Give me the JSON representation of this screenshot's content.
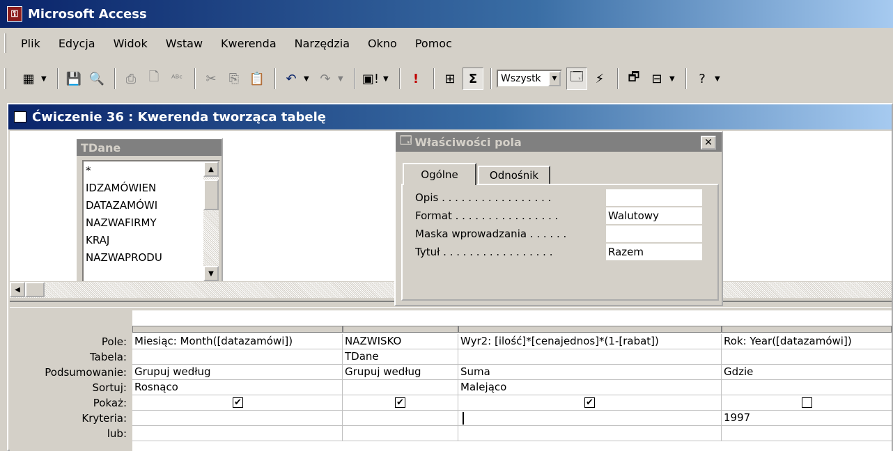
{
  "app": {
    "title": "Microsoft Access"
  },
  "menu": [
    "Plik",
    "Edycja",
    "Widok",
    "Wstaw",
    "Kwerenda",
    "Narzędzia",
    "Okno",
    "Pomoc"
  ],
  "toolbar": {
    "totals_combo": "Wszystk",
    "icons": [
      "view-icon",
      "save-icon",
      "print-icon",
      "undo-icon",
      "run-icon",
      "sigma-icon",
      "properties-icon",
      "help-icon"
    ]
  },
  "window": {
    "title": "Ćwiczenie 36 : Kwerenda tworząca tabelę"
  },
  "table_box": {
    "title": "TDane",
    "fields": [
      "*",
      "IDZAMÓWIEN",
      "DATAZAMÓWI",
      "NAZWAFIRMY",
      "KRAJ",
      "NAZWAPRODU"
    ]
  },
  "props": {
    "title": "Właściwości pola",
    "close": "✕",
    "tabs": [
      "Ogólne",
      "Odnośnik"
    ],
    "rows": [
      {
        "label": "Opis . . . . . . . . . . . . . . . . .",
        "value": ""
      },
      {
        "label": "Format . . . . . . . . . . . . . . . .",
        "value": "Walutowy"
      },
      {
        "label": "Maska wprowadzania . . . . . .",
        "value": ""
      },
      {
        "label": "Tytuł . . . . . . . . . . . . . . . . .",
        "value": "Razem"
      }
    ]
  },
  "grid": {
    "row_labels": [
      "Pole:",
      "Tabela:",
      "Podsumowanie:",
      "Sortuj:",
      "Pokaż:",
      "Kryteria:",
      "lub:"
    ],
    "columns": [
      {
        "pole": "Miesiąc: Month([datazamówi])",
        "tabela": "",
        "podsumowanie": "Grupuj według",
        "sortuj": "Rosnąco",
        "pokaz": "✔",
        "kryteria": "",
        "lub": ""
      },
      {
        "pole": "NAZWISKO",
        "tabela": "TDane",
        "podsumowanie": "Grupuj według",
        "sortuj": "",
        "pokaz": "✔",
        "kryteria": "",
        "lub": ""
      },
      {
        "pole": "Wyr2: [ilość]*[cenajednos]*(1-[rabat])",
        "tabela": "",
        "podsumowanie": "Suma",
        "sortuj": "Malejąco",
        "pokaz": "✔",
        "kryteria": "",
        "lub": ""
      },
      {
        "pole": "Rok: Year([datazamówi])",
        "tabela": "",
        "podsumowanie": "Gdzie",
        "sortuj": "",
        "pokaz": "",
        "kryteria": "1997",
        "lub": ""
      }
    ]
  }
}
